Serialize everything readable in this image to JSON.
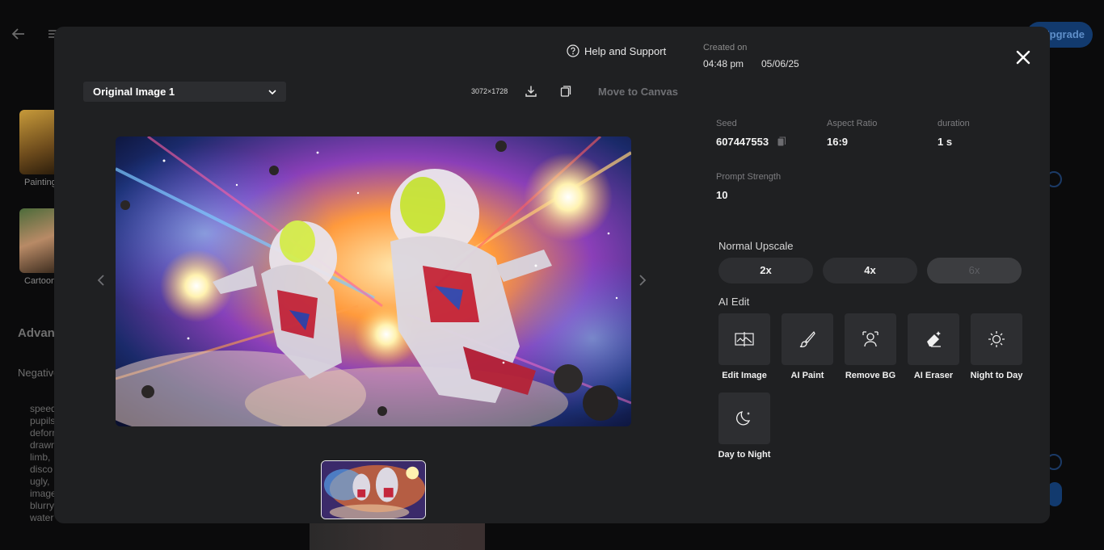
{
  "background": {
    "upgrade_label": "Upgrade",
    "style_1_label": "Painting",
    "style_2_label": "Cartoon",
    "advanced_label": "Advanced",
    "negative_label": "Negative",
    "negative_text": "speed pupils deform drawn limb, disco ugly, image blurry water"
  },
  "modal": {
    "help_label": "Help and Support",
    "created_label": "Created on",
    "created_time": "04:48 pm",
    "created_date": "05/06/25",
    "image_select": {
      "label": "Original Image 1"
    },
    "dimensions": "3072×1728",
    "move_to_canvas": "Move to Canvas",
    "details": {
      "seed_label": "Seed",
      "seed_value": "607447553",
      "aspect_label": "Aspect Ratio",
      "aspect_value": "16:9",
      "duration_label": "duration",
      "duration_value": "1 s",
      "prompt_strength_label": "Prompt Strength",
      "prompt_strength_value": "10"
    },
    "upscale": {
      "title": "Normal Upscale",
      "options": [
        "2x",
        "4x",
        "6x"
      ]
    },
    "ai_edit": {
      "title": "AI Edit",
      "tools": [
        {
          "label": "Edit Image",
          "icon": "edit-image-icon"
        },
        {
          "label": "AI Paint",
          "icon": "brush-icon"
        },
        {
          "label": "Remove BG",
          "icon": "remove-bg-icon"
        },
        {
          "label": "AI Eraser",
          "icon": "eraser-icon"
        },
        {
          "label": "Night to Day",
          "icon": "sun-icon"
        },
        {
          "label": "Day to Night",
          "icon": "moon-icon"
        }
      ]
    }
  }
}
